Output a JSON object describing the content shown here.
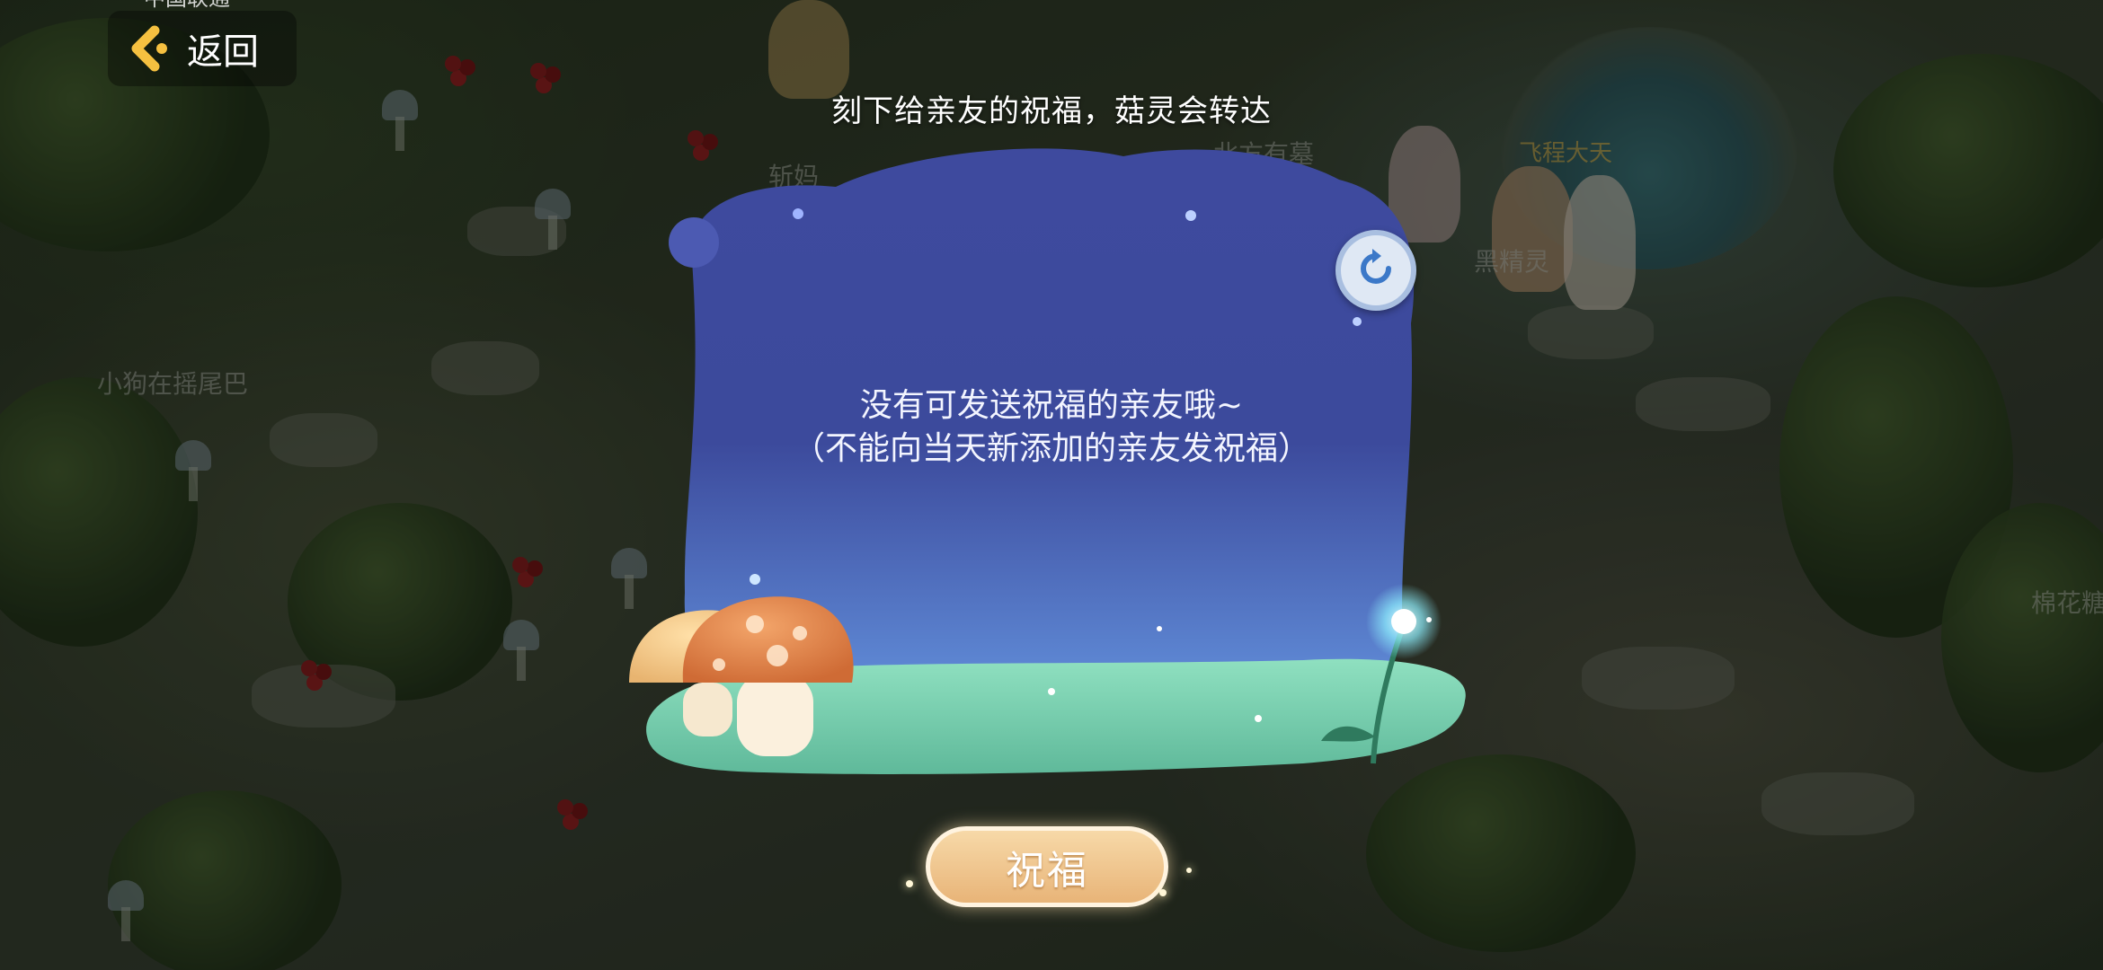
{
  "status_bar": {
    "carrier_text": "中国联通"
  },
  "top_bar": {
    "back_label": "返回"
  },
  "world": {
    "player_names": [
      "小狗在摇尾巴",
      "北方有墓",
      "飞程大天",
      "黑精灵",
      "棉花糖",
      "斩妈"
    ]
  },
  "dialog": {
    "title": "刻下给亲友的祝福，菇灵会转达",
    "empty_message": "没有可发送祝福的亲友哦~",
    "empty_note": "（不能向当天新添加的亲友发祝福）",
    "bless_button": "祝福"
  },
  "icons": {
    "back": "chevron-left-icon",
    "refresh": "refresh-icon"
  },
  "colors": {
    "card_top": "#3e4a9e",
    "card_bottom": "#5a7fd0",
    "ground": "#7fd0b0",
    "button": "#eec08a"
  }
}
